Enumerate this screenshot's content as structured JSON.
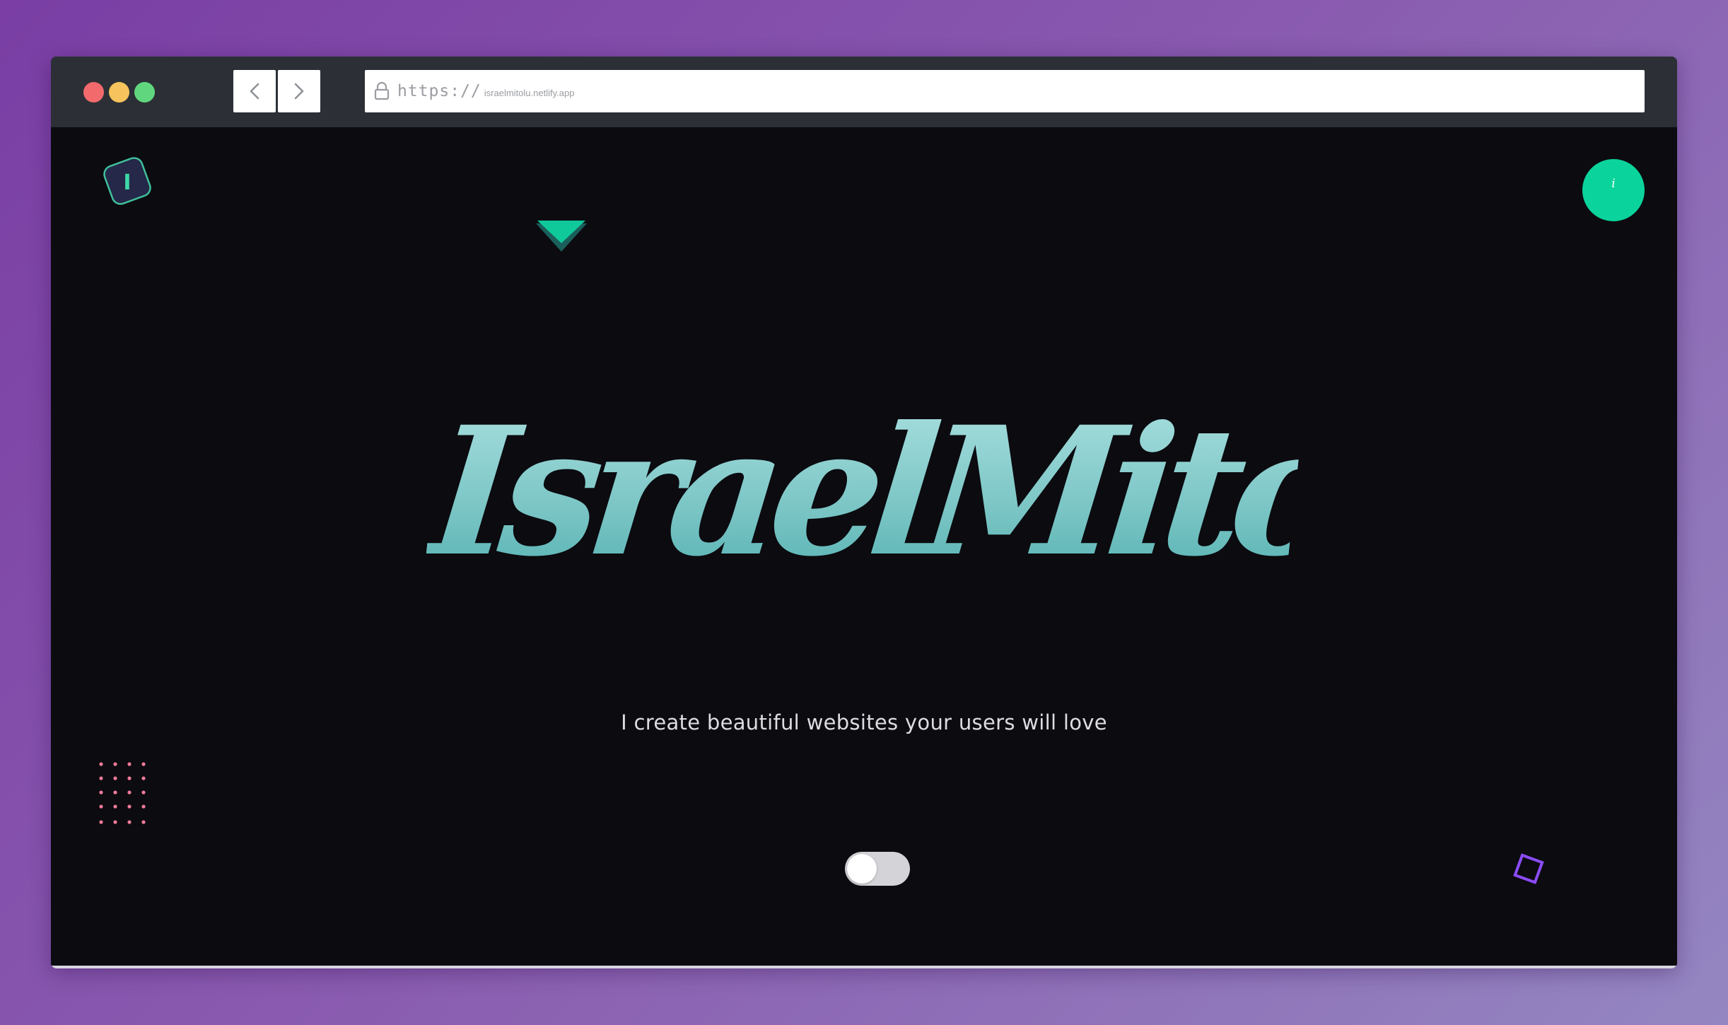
{
  "browser": {
    "url_scheme": "https://",
    "url_host": "israelmitolu.netlify.app",
    "back_icon": "chevron-left-icon",
    "forward_icon": "chevron-right-icon",
    "lock_icon": "lock-icon"
  },
  "header": {
    "logo_letter": "I",
    "info_label": "i"
  },
  "hero": {
    "title": "IsraelMitolu",
    "tagline": "I create beautiful websites your users will love"
  },
  "theme_toggle": {
    "state": "off"
  },
  "colors": {
    "accent": "#0ad49b",
    "title": "#82c8c8",
    "page_background": "#0b0b10",
    "dot_grid": "#f07a99",
    "square_outline": "#8b4cf6"
  }
}
